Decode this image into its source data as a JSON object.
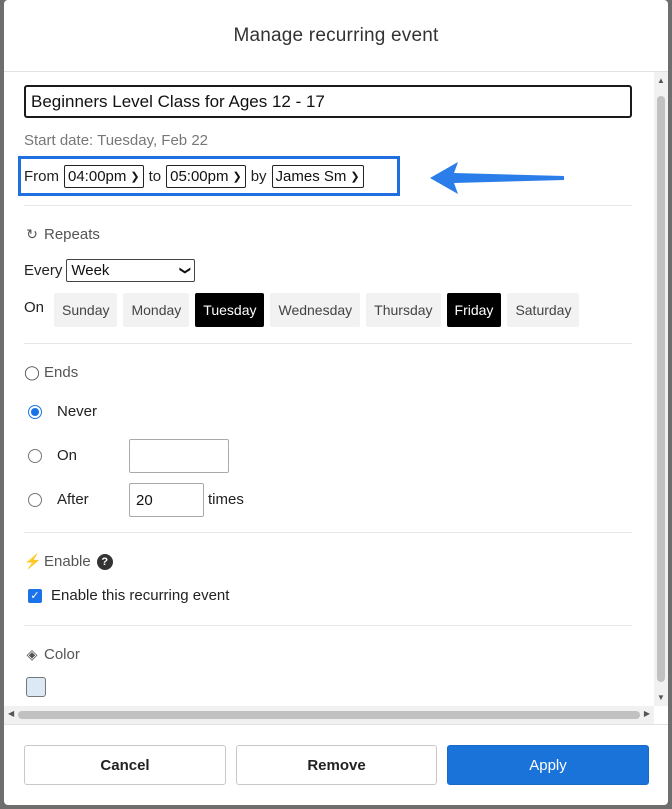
{
  "dialog": {
    "title": "Manage recurring event"
  },
  "event": {
    "title": "Beginners Level Class for Ages 12 - 17",
    "start_date": "Start date: Tuesday, Feb 22"
  },
  "time": {
    "from_label": "From",
    "from_value": "04:00pm",
    "to_label": "to",
    "to_value": "05:00pm",
    "by_label": "by",
    "by_value": "James Sm"
  },
  "repeats": {
    "label": "Repeats",
    "every_label": "Every",
    "every_value": "Week",
    "on_label": "On",
    "days": [
      {
        "label": "Sunday",
        "selected": false
      },
      {
        "label": "Monday",
        "selected": false
      },
      {
        "label": "Tuesday",
        "selected": true
      },
      {
        "label": "Wednesday",
        "selected": false
      },
      {
        "label": "Thursday",
        "selected": false
      },
      {
        "label": "Friday",
        "selected": true
      },
      {
        "label": "Saturday",
        "selected": false
      }
    ]
  },
  "ends": {
    "label": "Ends",
    "never_label": "Never",
    "on_label": "On",
    "on_value": "",
    "after_label": "After",
    "after_value": "20",
    "times_label": "times",
    "selected": "never"
  },
  "enable": {
    "label": "Enable",
    "help": "?",
    "checkbox_label": "Enable this recurring event",
    "checked": true
  },
  "color": {
    "label": "Color",
    "value": "#dbe9f7"
  },
  "footer": {
    "cancel_label": "Cancel",
    "remove_label": "Remove",
    "apply_label": "Apply"
  },
  "colors": {
    "accent": "#1a73d9",
    "highlight_border": "#1f6fe0",
    "arrow": "#2b7de9"
  },
  "icons": {
    "repeats": "refresh-icon",
    "ends": "circle-icon",
    "enable": "lightning-icon",
    "color": "paint-bucket-icon"
  }
}
